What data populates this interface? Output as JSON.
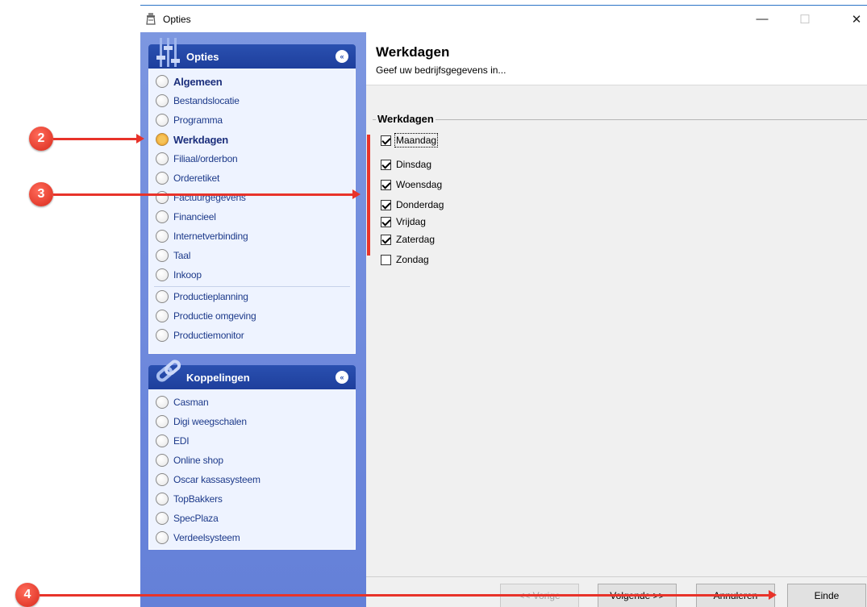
{
  "window": {
    "title": "Opties",
    "minimize_glyph": "—",
    "maximize_glyph": "☐",
    "close_glyph": "✕"
  },
  "sidebar": {
    "options_panel": {
      "title": "Opties",
      "collapse_glyph": "«",
      "items": [
        {
          "label": "Algemeen",
          "bold": true,
          "active": false
        },
        {
          "label": "Bestandslocatie"
        },
        {
          "label": "Programma"
        },
        {
          "label": "Werkdagen",
          "bold": true,
          "active": true
        },
        {
          "label": "Filiaal/orderbon"
        },
        {
          "label": "Orderetiket"
        },
        {
          "label": "Factuurgegevens"
        },
        {
          "label": "Financieel"
        },
        {
          "label": "Internetverbinding"
        },
        {
          "label": "Taal"
        },
        {
          "label": "Inkoop"
        },
        {
          "label": "Productieplanning"
        },
        {
          "label": "Productie omgeving"
        },
        {
          "label": "Productiemonitor"
        }
      ]
    },
    "links_panel": {
      "title": "Koppelingen",
      "collapse_glyph": "«",
      "items": [
        {
          "label": "Casman"
        },
        {
          "label": "Digi weegschalen"
        },
        {
          "label": "EDI"
        },
        {
          "label": "Online shop"
        },
        {
          "label": "Oscar kassasysteem"
        },
        {
          "label": "TopBakkers"
        },
        {
          "label": "SpecPlaza"
        },
        {
          "label": "Verdeelsysteem"
        }
      ]
    }
  },
  "content": {
    "title": "Werkdagen",
    "subtitle": "Geef uw bedrijfsgegevens in...",
    "group_title": "Werkdagen",
    "days": [
      {
        "label": "Maandag",
        "checked": true
      },
      {
        "label": "Dinsdag",
        "checked": true
      },
      {
        "label": "Woensdag",
        "checked": true
      },
      {
        "label": "Donderdag",
        "checked": true
      },
      {
        "label": "Vrijdag",
        "checked": true
      },
      {
        "label": "Zaterdag",
        "checked": true
      },
      {
        "label": "Zondag",
        "checked": false
      }
    ]
  },
  "buttons": {
    "prev": "<< Vorige",
    "next": "Volgende >>",
    "cancel": "Annuleren",
    "end": "Einde"
  },
  "annotations": {
    "markers": [
      "2",
      "3",
      "4"
    ]
  },
  "colors": {
    "accent": "#1e3f9c",
    "annotation": "#e8332a",
    "active_radio": "#f2a935"
  }
}
